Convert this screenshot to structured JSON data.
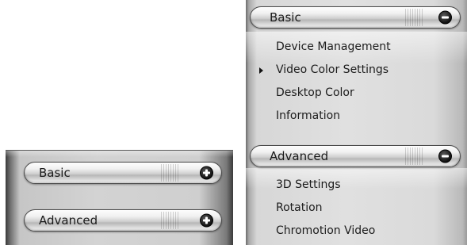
{
  "collapsed_panel": {
    "basic": {
      "label": "Basic",
      "toggle_icon": "plus-icon"
    },
    "advanced": {
      "label": "Advanced",
      "toggle_icon": "plus-icon"
    }
  },
  "expanded_panel": {
    "basic": {
      "label": "Basic",
      "toggle_icon": "minus-icon",
      "items": [
        {
          "label": "Device Management"
        },
        {
          "label": "Video Color Settings",
          "selected": true
        },
        {
          "label": "Desktop Color"
        },
        {
          "label": "Information"
        }
      ]
    },
    "advanced": {
      "label": "Advanced",
      "toggle_icon": "minus-icon",
      "items": [
        {
          "label": "3D Settings"
        },
        {
          "label": "Rotation"
        },
        {
          "label": "Chromotion Video"
        }
      ]
    }
  }
}
